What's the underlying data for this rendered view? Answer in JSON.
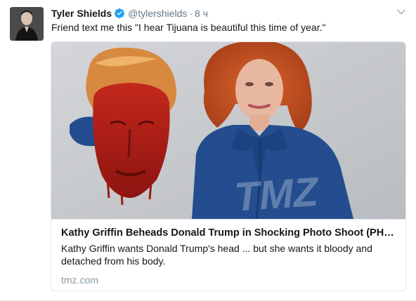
{
  "tweet": {
    "author_name": "Tyler Shields",
    "handle": "@tylershields",
    "separator": "·",
    "time": "8 ч",
    "text": "Friend text me this \"I hear Tijuana is beautiful this time of year.\""
  },
  "card": {
    "image_watermark": "TMZ",
    "title": "Kathy Griffin Beheads Donald Trump in Shocking Photo Shoot (PHO..",
    "description": "Kathy Griffin wants Donald Trump's head ... but she wants it bloody and detached from his body.",
    "domain": "tmz.com"
  },
  "colors": {
    "verified": "#1da1f2",
    "secondary_text": "#657786",
    "domain_text": "#8899a6",
    "border": "#e1e8ed"
  }
}
